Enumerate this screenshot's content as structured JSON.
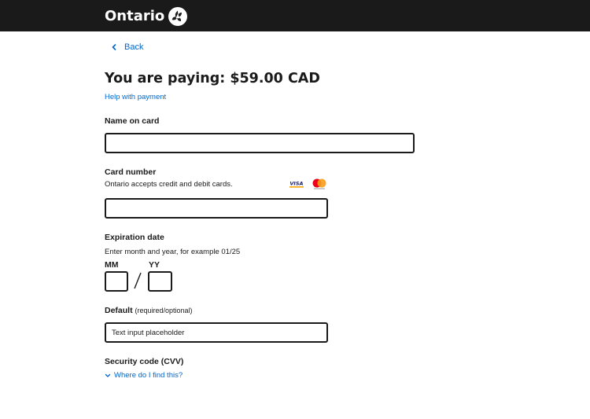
{
  "header": {
    "brand": "Ontario",
    "logo_icon": "trillium-logo-icon",
    "background": "#1a1a1a"
  },
  "nav": {
    "back_label": "Back"
  },
  "payment": {
    "title": "You are paying: $59.00 CAD",
    "help_link": "Help with payment"
  },
  "form": {
    "name_on_card": {
      "label": "Name on card",
      "value": ""
    },
    "card_number": {
      "label": "Card number",
      "hint": "Ontario accepts credit and debit cards.",
      "value": "",
      "accepted_cards": [
        "VISA",
        "mastercard"
      ]
    },
    "expiration": {
      "label": "Expiration date",
      "hint": "Enter month and year, for example 01/25",
      "month_label": "MM",
      "year_label": "YY",
      "month_value": "",
      "year_value": ""
    },
    "default_field": {
      "label": "Default",
      "qualifier": "(required/optional)",
      "placeholder": "Text input placeholder"
    },
    "security_code": {
      "label": "Security code (CVV)",
      "disclosure": "Where do I find this?"
    }
  },
  "colors": {
    "link": "#0066cc",
    "text": "#1a1a1a",
    "visa_blue": "#1a1f71",
    "visa_gold": "#f7a600",
    "mastercard_red": "#eb001b",
    "mastercard_yellow": "#f79e1b"
  }
}
